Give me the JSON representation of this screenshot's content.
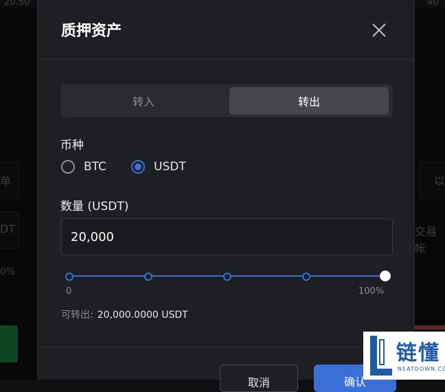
{
  "background": {
    "top_left_text": "20.50",
    "top_right_text": "40",
    "left_fragment_1": "单",
    "left_fragment_2": "DT",
    "left_fragment_3": "0%",
    "right_fragment_1": "以",
    "right_fragment_2": "交易帐"
  },
  "modal": {
    "title": "质押资产",
    "tabs": [
      {
        "label": "转入",
        "active": false
      },
      {
        "label": "转出",
        "active": true
      }
    ],
    "currency_label": "币种",
    "currency_options": [
      {
        "label": "BTC",
        "selected": false
      },
      {
        "label": "USDT",
        "selected": true
      }
    ],
    "amount_label": "数量 (USDT)",
    "amount_value": "20,000",
    "slider": {
      "value_percent": 100,
      "min_label": "0",
      "max_label": "100%"
    },
    "available_label": "可转出:",
    "available_value": "20,000.0000 USDT",
    "cancel_label": "取消",
    "confirm_label": "确认"
  },
  "watermark": {
    "cn": "链懂",
    "en": "NEATDOWN.COM"
  },
  "colors": {
    "accent": "#3a6fd8",
    "modal_bg": "#1e1f22"
  }
}
